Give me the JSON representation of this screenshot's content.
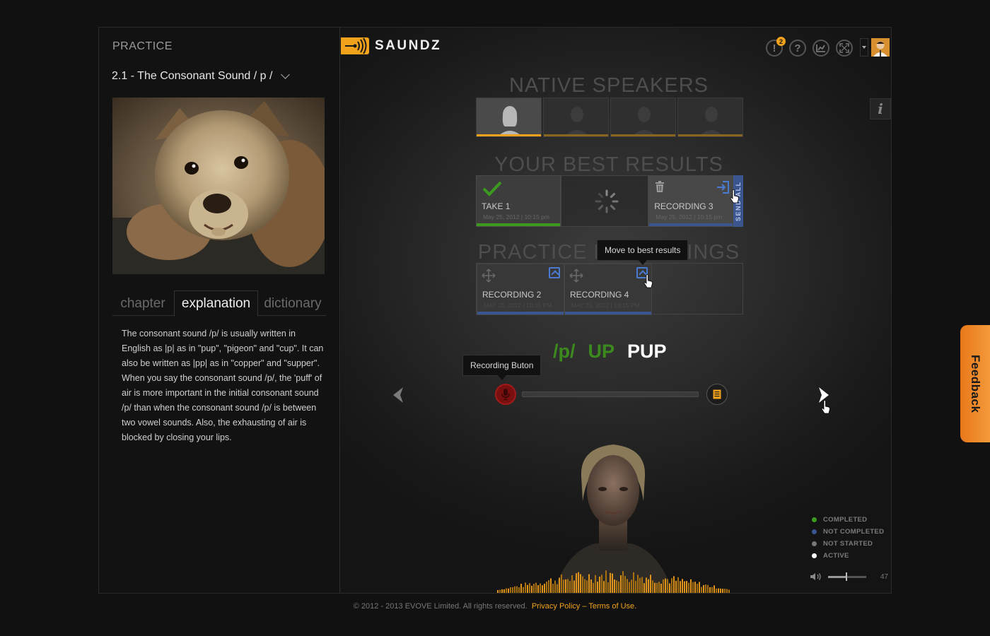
{
  "sidebar": {
    "title": "PRACTICE",
    "lesson": "2.1 - The Consonant Sound  / p /",
    "tabs": [
      {
        "label": "chapter"
      },
      {
        "label": "explanation"
      },
      {
        "label": "dictionary"
      }
    ],
    "active_tab": "explanation",
    "explanation": "The consonant sound /p/ is usually written in English as |p| as in \"pup\", \"pigeon\" and \"cup\". It can also be written as |pp| as in \"copper\" and \"supper\". When you say the consonant sound /p/, the 'puff' of air is more important in the initial consonant sound /p/ than when the consonant sound /p/ is between two vowel sounds. Also, the exhausting of air is blocked by closing your lips."
  },
  "header": {
    "logo_text": "SAUNDZ",
    "notification_count": "2",
    "help_icon_text": "?",
    "alert_icon_text": "!"
  },
  "native_speakers": {
    "title": "NATIVE SPEAKERS",
    "selected_index": 0,
    "count": 4
  },
  "best_results": {
    "title": "YOUR BEST RESULTS",
    "items": [
      {
        "label": "TAKE 1",
        "date": "May 25, 2012 | 10:15 pm",
        "status": "completed"
      },
      {
        "label": "RECORDING 3",
        "date": "May 25, 2012 | 10:15 pm",
        "status": "not-completed"
      }
    ],
    "send_all_label": "SEND ALL"
  },
  "practice_recordings": {
    "title": "PRACTICE RECORDINGS",
    "items": [
      {
        "label": "RECORDING  2",
        "date": "MAY 25, 2012 | 10:15 PM"
      },
      {
        "label": "RECORDING  4",
        "date": "MAY 25, 2012 | 10:15 PM"
      }
    ]
  },
  "tooltips": {
    "move": "Move to best results",
    "record": "Recording Buton"
  },
  "word": {
    "phoneme": "/p/",
    "part": "UP",
    "word": "PUP"
  },
  "recorder": {
    "progress": 0
  },
  "legend": [
    {
      "label": "COMPLETED",
      "color": "#3c9a1e"
    },
    {
      "label": "NOT COMPLETED",
      "color": "#3a5590"
    },
    {
      "label": "NOT STARTED",
      "color": "#777777"
    },
    {
      "label": "ACTIVE",
      "color": "#ffffff"
    }
  ],
  "volume": {
    "value": "47",
    "level": 0.47
  },
  "feedback_label": "Feedback",
  "footer": {
    "copyright": "© 2012 - 2013 EVOVE Limited. All rights reserved.",
    "privacy": "Privacy Policy",
    "separator": "–",
    "terms": "Terms of Use."
  },
  "colors": {
    "accent": "#f2a21b",
    "completed": "#3c9a1e",
    "not_completed": "#3a5590",
    "record": "#a31a1a"
  }
}
